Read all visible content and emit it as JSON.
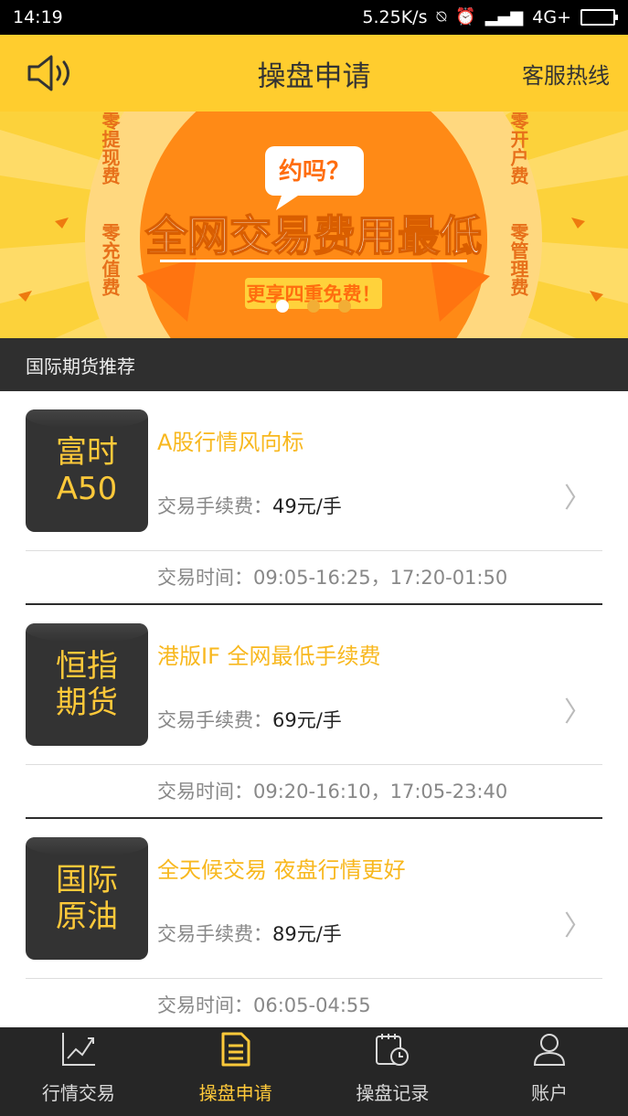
{
  "status_bar": {
    "time": "14:19",
    "speed": "5.25K/s",
    "network": "4G+"
  },
  "header": {
    "title": "操盘申请",
    "hotline_label": "客服热线"
  },
  "banner": {
    "bubble_text": "约吗？",
    "headline": "全网交易费用最低",
    "subline": "更享四重免费！",
    "perks": [
      "零提现费",
      "零充值费",
      "零开户费",
      "零管理费"
    ],
    "active_index": 0,
    "colors": {
      "bg": "#fcd23b",
      "circle": "#ff8a16",
      "ring": "#ffd87f"
    }
  },
  "section": {
    "title": "国际期货推荐"
  },
  "products": [
    {
      "badge_line1": "富时",
      "badge_line2": "A50",
      "title": "A股行情风向标",
      "fee_label": "交易手续费：",
      "fee_value": "49元/手",
      "time_label": "交易时间：09:05-16:25，17:20-01:50"
    },
    {
      "badge_line1": "恒指",
      "badge_line2": "期货",
      "title": "港版IF 全网最低手续费",
      "fee_label": "交易手续费：",
      "fee_value": "69元/手",
      "time_label": "交易时间：09:20-16:10，17:05-23:40"
    },
    {
      "badge_line1": "国际",
      "badge_line2": "原油",
      "title": "全天候交易 夜盘行情更好",
      "fee_label": "交易手续费：",
      "fee_value": "89元/手",
      "time_label": "交易时间：06:05-04:55"
    }
  ],
  "tabs": [
    {
      "label": "行情交易",
      "icon": "chart-icon",
      "active": false
    },
    {
      "label": "操盘申请",
      "icon": "document-icon",
      "active": true
    },
    {
      "label": "操盘记录",
      "icon": "calendar-clock-icon",
      "active": false
    },
    {
      "label": "账户",
      "icon": "user-icon",
      "active": false
    }
  ],
  "colors": {
    "header": "#ffcd2e",
    "accent": "#ffc93a",
    "dark": "#2f2f2f"
  }
}
